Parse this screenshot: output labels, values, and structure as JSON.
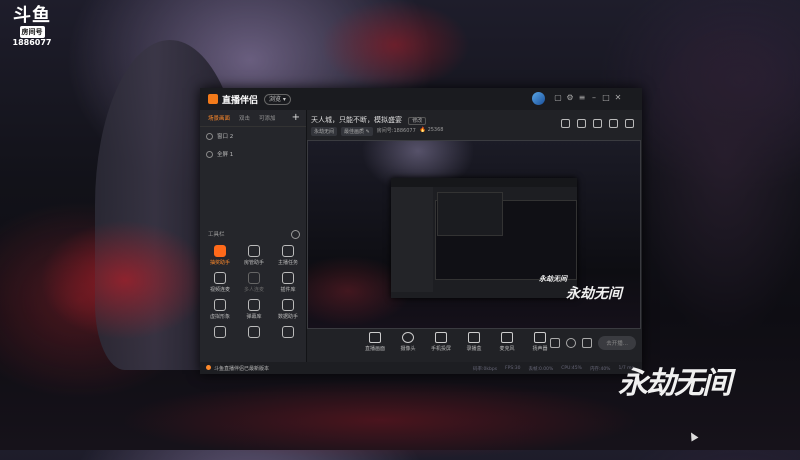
{
  "overlay": {
    "logo": "斗鱼",
    "room_label": "房间号",
    "room_number": "1886077"
  },
  "app": {
    "name": "直播伴侣",
    "badge": "浏览 ▾",
    "left_tabs": [
      "场景画面",
      "双击",
      "可添加"
    ],
    "scenes": [
      "窗口 2",
      "全屏 1"
    ],
    "tools_title": "工具栏",
    "tools": [
      {
        "label": "抽奖助手",
        "icon": "gift-icon",
        "state": "active"
      },
      {
        "label": "房管助手",
        "icon": "user-icon",
        "state": "normal"
      },
      {
        "label": "主播任务",
        "icon": "task-icon",
        "state": "normal"
      },
      {
        "label": "视频连麦",
        "icon": "video-call-icon",
        "state": "normal"
      },
      {
        "label": "多人连麦",
        "icon": "multi-call-icon",
        "state": "dim"
      },
      {
        "label": "插件库",
        "icon": "plugin-icon",
        "state": "normal"
      },
      {
        "label": "虚拟形象",
        "icon": "avatar-icon",
        "state": "normal"
      },
      {
        "label": "弹幕库",
        "icon": "danmaku-icon",
        "state": "normal"
      },
      {
        "label": "数据助手",
        "icon": "data-icon",
        "state": "normal"
      },
      {
        "label": "",
        "icon": "tool-icon",
        "state": "normal"
      },
      {
        "label": "",
        "icon": "up-icon",
        "state": "normal"
      },
      {
        "label": "",
        "icon": "layers-icon",
        "state": "normal"
      }
    ],
    "status_text": "斗鱼直播伴侣已最新版本"
  },
  "room": {
    "title": "天人城，只能不断，模拟盛宴",
    "edit_label": "修改",
    "tags": [
      "永劫无间",
      "最佳画质 ✎"
    ],
    "meta_room": "房间号:1886077",
    "meta_fans": "🔥 25368"
  },
  "preview": {
    "inner_brand": "永劫无间",
    "brand": "永劫无间"
  },
  "controls": [
    {
      "label": "直播画面",
      "icon": "monitor-icon"
    },
    {
      "label": "摄像头",
      "icon": "camera-icon"
    },
    {
      "label": "手机投屏",
      "icon": "phone-cast-icon"
    },
    {
      "label": "录播盒",
      "icon": "play-icon"
    },
    {
      "label": "麦克风",
      "icon": "mic-icon"
    },
    {
      "label": "扬声器",
      "icon": "speaker-icon"
    }
  ],
  "go_live_label": "去开播...",
  "stats": [
    "码率:0kbps",
    "FPS:30",
    "丢帧:0.00%",
    "CPU:45%",
    "内存:40%",
    "1/7 ms"
  ],
  "bottom_brand": "永劫无间"
}
